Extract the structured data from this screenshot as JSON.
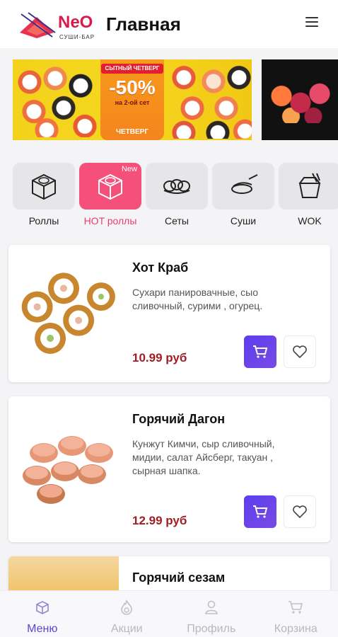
{
  "header": {
    "logo_word": "NeO",
    "logo_sub": "СУШИ-БАР",
    "title": "Главная"
  },
  "banner": {
    "tag": "СЫТНЫЙ ЧЕТВЕРГ",
    "discount": "-50%",
    "line": "на 2-ой сет",
    "day": "ЧЕТВЕРГ"
  },
  "categories": [
    {
      "label": "Роллы",
      "icon": "roll-icon",
      "active": false
    },
    {
      "label": "HOT роллы",
      "icon": "hot-roll-icon",
      "active": true,
      "badge": "New"
    },
    {
      "label": "Сеты",
      "icon": "set-icon",
      "active": false
    },
    {
      "label": "Суши",
      "icon": "sushi-icon",
      "active": false
    },
    {
      "label": "WOK",
      "icon": "wok-box-icon",
      "active": false
    }
  ],
  "products": [
    {
      "title": "Хот Краб",
      "desc": "Сухари панировачные, сыо сливочный, сурими , огурец.",
      "price": "10.99 руб"
    },
    {
      "title": "Горячий Дагон",
      "desc": "Кунжут Кимчи, сыр сливочный, мидии, салат Айсберг, такуан , сырная шапка.",
      "price": "12.99 руб"
    },
    {
      "title": "Горячий сезам"
    }
  ],
  "tabs": [
    {
      "label": "Меню",
      "icon": "menu-box-icon",
      "active": true
    },
    {
      "label": "Акции",
      "icon": "flame-icon",
      "active": false
    },
    {
      "label": "Профиль",
      "icon": "person-icon",
      "active": false
    },
    {
      "label": "Корзина",
      "icon": "cart-icon",
      "active": false
    }
  ],
  "colors": {
    "accent": "#5b3df0",
    "pink": "#f4507a",
    "price": "#a21c24"
  }
}
